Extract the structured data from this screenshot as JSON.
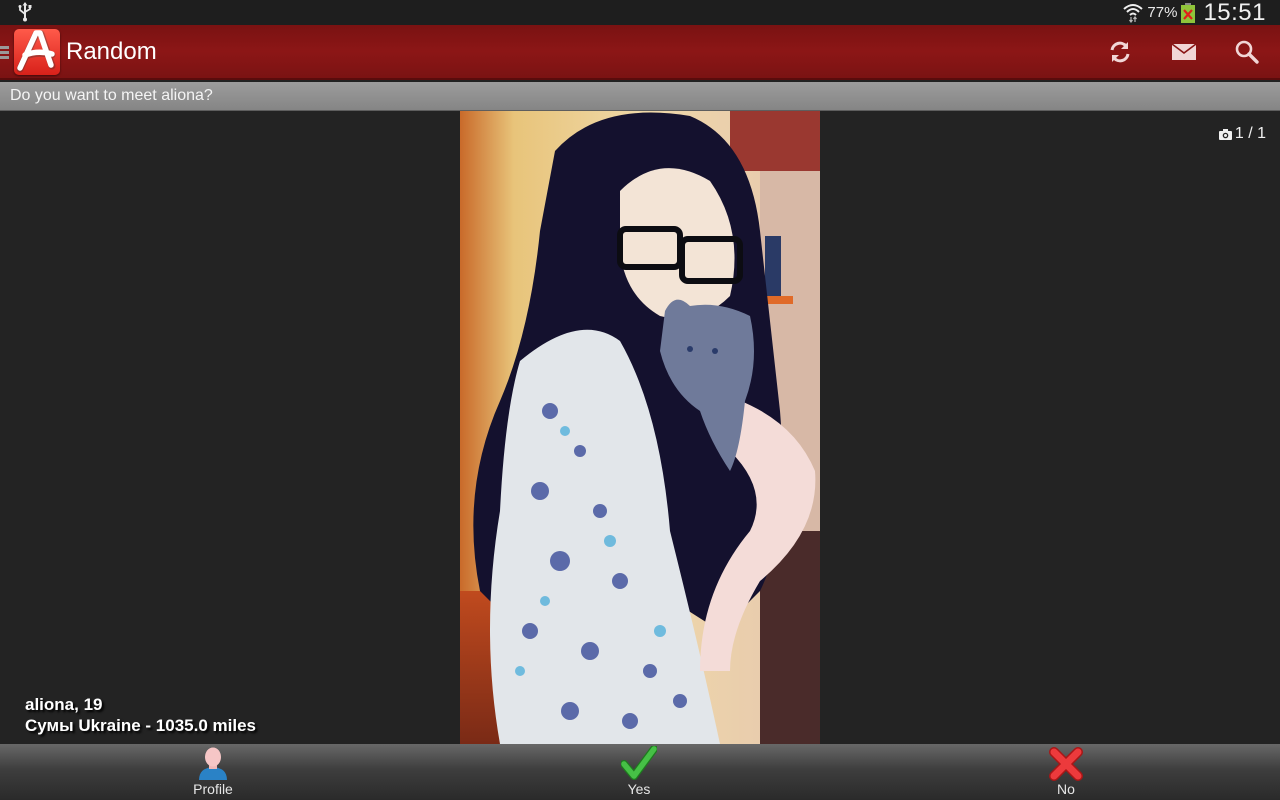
{
  "status_bar": {
    "battery_percent": "77%",
    "time": "15:51",
    "icons": [
      "usb-icon",
      "wifi-icon",
      "battery-charging-icon"
    ]
  },
  "action_bar": {
    "title": "Random",
    "actions": [
      {
        "name": "refresh-icon",
        "label": "Refresh"
      },
      {
        "name": "mail-icon",
        "label": "Messages"
      },
      {
        "name": "search-icon",
        "label": "Search"
      }
    ],
    "brand_color": "#8c1616"
  },
  "prompt": "Do you want to meet aliona?",
  "photo": {
    "counter": "1 / 1",
    "current": 1,
    "total": 1
  },
  "profile": {
    "name_age": "aliona, 19",
    "location": "Сумы Ukraine - 1035.0 miles"
  },
  "bottom_bar": {
    "profile_label": "Profile",
    "yes_label": "Yes",
    "no_label": "No",
    "yes_color": "#3cb83c",
    "no_color": "#e0282a"
  }
}
